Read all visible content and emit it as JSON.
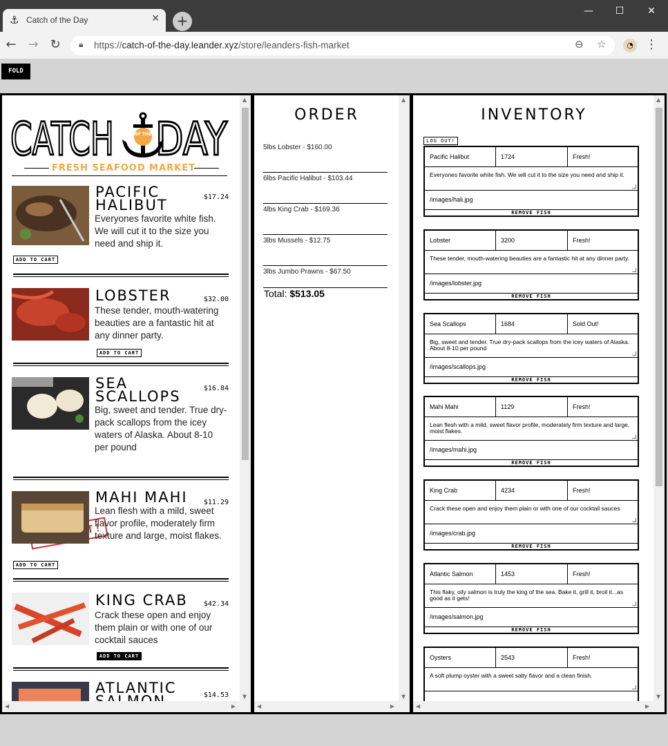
{
  "browser": {
    "tab_title": "Catch of the Day",
    "url_prefix": "https://",
    "url_host": "catch-of-the-day.leander.xyz",
    "url_path": "/store/leanders-fish-market"
  },
  "page": {
    "fold_label": "FOLD"
  },
  "menu": {
    "logo_left": "CATCH",
    "logo_mid": "OF THE",
    "logo_right": "DAY",
    "tagline": "FRESH SEAFOOD MARKET",
    "items": [
      {
        "name": "Pacific Halibut",
        "price": "$17.24",
        "desc": "Everyones favorite white fish. We will cut it to the size you need and ship it.",
        "button": "ADD TO CART"
      },
      {
        "name": "Lobster",
        "price": "$32.00",
        "desc": "These tender, mouth-watering beauties are a fantastic hit at any dinner party.",
        "button": "ADD TO CART"
      },
      {
        "name": "Sea Scallops",
        "price": "$16.84",
        "desc": "Big, sweet and tender. True dry-pack scallops from the icey waters of Alaska. About 8-10 per pound",
        "button": "SOLD OUT!"
      },
      {
        "name": "Mahi Mahi",
        "price": "$11.29",
        "desc": "Lean flesh with a mild, sweet flavor profile, moderately firm texture and large, moist flakes.",
        "button": "ADD TO CART"
      },
      {
        "name": "King Crab",
        "price": "$42.34",
        "desc": "Crack these open and enjoy them plain or with one of our cocktail sauces",
        "button": "ADD TO CART"
      },
      {
        "name": "Atlantic Salmon",
        "price": "$14.53",
        "desc": "",
        "button": ""
      }
    ]
  },
  "order": {
    "title": "ORDER",
    "lines": [
      "5lbs Lobster - $160.00",
      "6lbs Pacific Halibut - $103.44",
      "4lbs King Crab - $169.36",
      "3lbs Mussels - $12.75",
      "3lbs Jumbo Prawns - $67.50"
    ],
    "total_label": "Total:",
    "total_value": "$513.05"
  },
  "inventory": {
    "title": "INVENTORY",
    "logout_label": "LOG OUT!",
    "remove_label": "REMOVE FISH",
    "fish": [
      {
        "name": "Pacific Halibut",
        "price": "1724",
        "status": "Fresh!",
        "desc": "Everyones favorite white fish. We will cut it to the size you need and ship it.",
        "image": "/images/hali.jpg"
      },
      {
        "name": "Lobster",
        "price": "3200",
        "status": "Fresh!",
        "desc": "These tender, mouth-watering beauties are a fantastic hit at any dinner party.",
        "image": "/images/lobster.jpg"
      },
      {
        "name": "Sea Scallops",
        "price": "1684",
        "status": "Sold Out!",
        "desc": "Big, sweet and tender. True dry-pack scallops from the icey waters of Alaska. About 8-10 per pound",
        "image": "/images/scallops.jpg"
      },
      {
        "name": "Mahi Mahi",
        "price": "1129",
        "status": "Fresh!",
        "desc": "Lean flesh with a mild, sweet flavor profile, moderately firm texture and large, moist flakes.",
        "image": "/images/mahi.jpg"
      },
      {
        "name": "King Crab",
        "price": "4234",
        "status": "Fresh!",
        "desc": "Crack these open and enjoy them plain or with one of our cocktail sauces",
        "image": "/images/crab.jpg"
      },
      {
        "name": "Atlantic Salmon",
        "price": "1453",
        "status": "Fresh!",
        "desc": "This flaky, oily salmon is truly the king of the sea. Bake it, grill it, broil it...as good as it gets!",
        "image": "/images/salmon.jpg"
      },
      {
        "name": "Oysters",
        "price": "2543",
        "status": "Fresh!",
        "desc": "A soft plump oyster with a sweet salty flavor and a clean finish.",
        "image": ""
      }
    ]
  },
  "colors": {
    "accent": "#f2a945",
    "sold_out": "#c8323c"
  }
}
